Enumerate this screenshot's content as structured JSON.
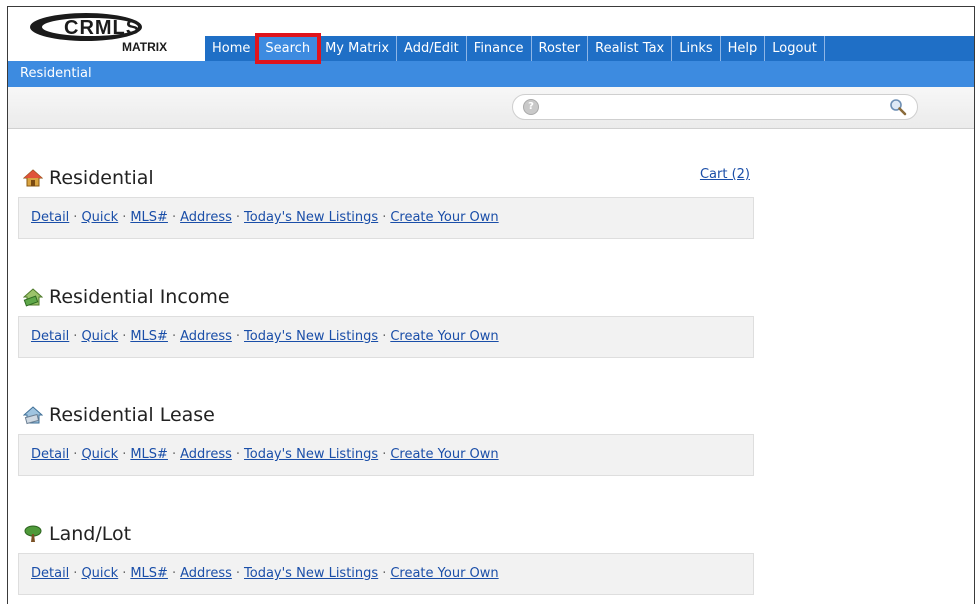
{
  "logo": {
    "top_text": "CRMLS",
    "bottom_text": "MATRIX"
  },
  "nav": {
    "items": [
      "Home",
      "Search",
      "My Matrix",
      "Add/Edit",
      "Finance",
      "Roster",
      "Realist Tax",
      "Links",
      "Help",
      "Logout"
    ],
    "active": "Search"
  },
  "subnav": {
    "label": "Residential"
  },
  "search": {
    "value": "",
    "placeholder": "",
    "help_glyph": "?"
  },
  "cart": {
    "label": "Cart (2)"
  },
  "sections": [
    {
      "title": "Residential",
      "icon": "house-icon",
      "links": [
        "Detail",
        "Quick",
        "MLS#",
        "Address",
        "Today's New Listings",
        "Create Your Own"
      ]
    },
    {
      "title": "Residential Income",
      "icon": "income-house-icon",
      "links": [
        "Detail",
        "Quick",
        "MLS#",
        "Address",
        "Today's New Listings",
        "Create Your Own"
      ]
    },
    {
      "title": "Residential Lease",
      "icon": "lease-house-icon",
      "links": [
        "Detail",
        "Quick",
        "MLS#",
        "Address",
        "Today's New Listings",
        "Create Your Own"
      ]
    },
    {
      "title": "Land/Lot",
      "icon": "tree-icon",
      "links": [
        "Detail",
        "Quick",
        "MLS#",
        "Address",
        "Today's New Listings",
        "Create Your Own"
      ]
    }
  ],
  "link_separator": "·",
  "colors": {
    "nav_blue": "#1f6fc6",
    "subnav_blue": "#3d8be0",
    "highlight_red": "#e0141c",
    "link_blue": "#1a4ea8"
  }
}
